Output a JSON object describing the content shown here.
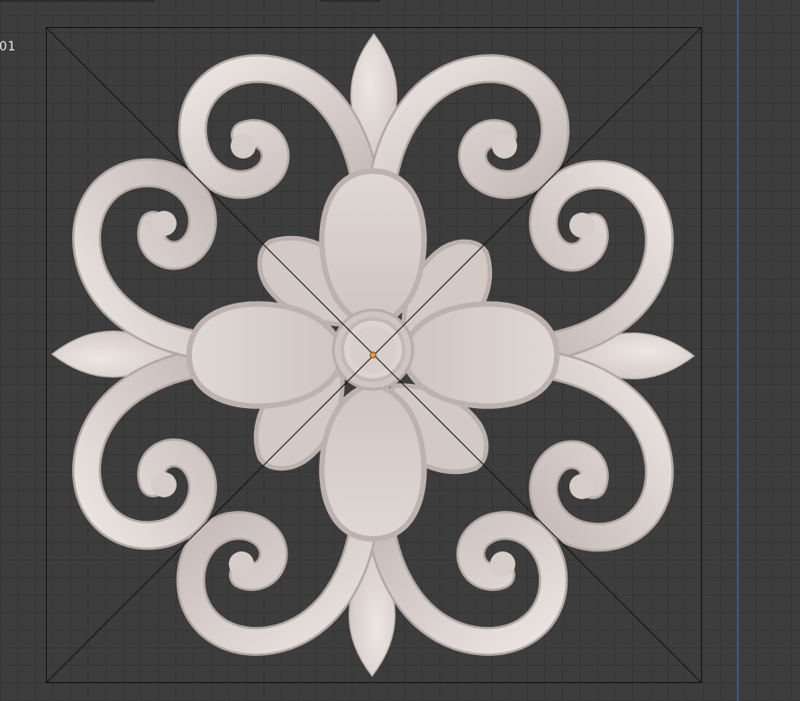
{
  "viewport": {
    "object_label": "01",
    "background_color": "#3d3d3d",
    "grid_color": "#353535",
    "axis_color": "#3a5a8e",
    "model_color": "#e2d9d6",
    "origin_color": "#f0a030"
  },
  "icons": {
    "origin": "origin-dot-icon"
  }
}
